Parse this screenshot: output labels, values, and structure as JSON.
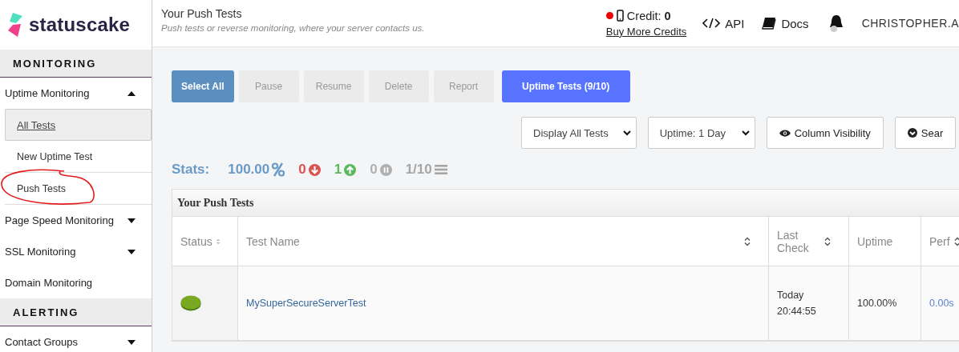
{
  "brand": {
    "name": "statuscake"
  },
  "header": {
    "title": "Your Push Tests",
    "subtitle": "Push tests or reverse monitoring, where your server contacts us.",
    "credit_dot": {
      "color": "#ee0000"
    },
    "credit": "Credit: **0**",
    "buy_link": "Buy More Credits",
    "links": [
      {
        "kind": "api",
        "label": "API"
      },
      {
        "kind": "docs",
        "label": "Docs"
      }
    ],
    "user": "CHRISTOPHER.A"
  },
  "sidebar": {
    "sections": [
      {
        "title": "MONITORING",
        "items": [
          {
            "label": "Uptime Monitoring",
            "expanded": true,
            "children": [
              {
                "label": "All Tests",
                "selected": true
              },
              {
                "label": "New Uptime Test",
                "selected": false
              },
              {
                "label": "Push Tests",
                "selected": false,
                "circled": true
              }
            ]
          },
          {
            "label": "Page Speed Monitoring",
            "expanded": false
          },
          {
            "label": "SSL Monitoring",
            "expanded": false
          },
          {
            "label": "Domain Monitoring"
          }
        ]
      },
      {
        "title": "ALERTING",
        "items": [
          {
            "label": "Contact Groups",
            "expanded": false
          }
        ]
      }
    ]
  },
  "actions": [
    {
      "label": "Select All",
      "kind": "primary",
      "disabled": false
    },
    {
      "label": "Pause",
      "kind": "default",
      "disabled": true
    },
    {
      "label": "Resume",
      "kind": "default",
      "disabled": true
    },
    {
      "label": "Delete",
      "kind": "default",
      "disabled": true
    },
    {
      "label": "Report",
      "kind": "default",
      "disabled": true
    },
    {
      "label": "Uptime Tests **(9/10)**",
      "kind": "accent",
      "disabled": false
    }
  ],
  "filters": [
    {
      "kind": "select",
      "label": "Display All Tests"
    },
    {
      "kind": "select",
      "label": "Uptime: 1 Day"
    },
    {
      "kind": "eye",
      "label": "Column Visibility"
    },
    {
      "kind": "search",
      "label": "Sear"
    }
  ],
  "stats": {
    "label": "Stats:",
    "items": [
      {
        "kind": "uptime",
        "value": "100.00",
        "color": "#6a9bc8"
      },
      {
        "kind": "down",
        "value": "0",
        "color": "#d9534f"
      },
      {
        "kind": "up",
        "value": "1",
        "color": "#5cb85c"
      },
      {
        "kind": "paused",
        "value": "0",
        "color": "#b0b0b0"
      },
      {
        "kind": "count",
        "value": "1/10",
        "color": "#a6a6a6"
      }
    ]
  },
  "table": {
    "title": "Your Push Tests",
    "columns": [
      {
        "label": "Status",
        "sortable": true
      },
      {
        "label": "Test Name",
        "sortable": true
      },
      {
        "label": "Last Check",
        "sortable": true
      },
      {
        "label": "Uptime",
        "sortable": false
      },
      {
        "label": "Perf",
        "sortable": true
      }
    ],
    "rows": [
      {
        "online": true,
        "name": "MySuperSecureServerTest",
        "last_check": [
          "Today",
          "20:44:55"
        ],
        "uptime": "100.00%",
        "perf": "0.00s"
      }
    ]
  }
}
